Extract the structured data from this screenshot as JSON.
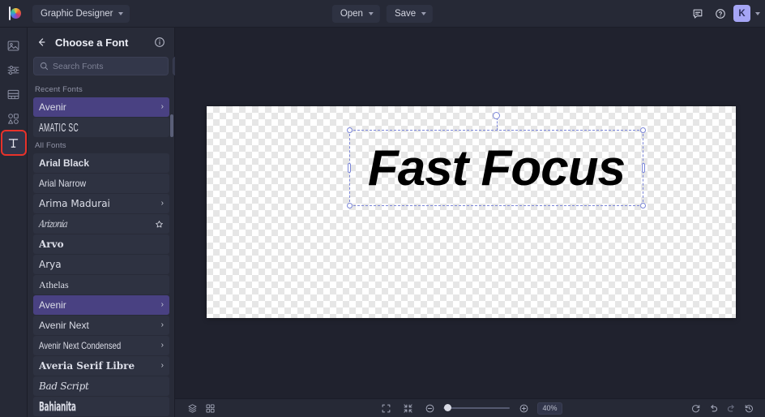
{
  "app": {
    "document_name": "Graphic Designer",
    "logo_icon": "pixlr-logo-icon"
  },
  "topbar": {
    "open_label": "Open",
    "save_label": "Save",
    "chat_icon": "chat-bubble-icon",
    "help_icon": "help-circle-icon",
    "avatar_initial": "K"
  },
  "left_rail": [
    {
      "name": "sidebar-item-image",
      "icon": "image-icon",
      "active": false
    },
    {
      "name": "sidebar-item-adjust",
      "icon": "sliders-icon",
      "active": false
    },
    {
      "name": "sidebar-item-layout",
      "icon": "layout-icon",
      "active": false
    },
    {
      "name": "sidebar-item-shapes",
      "icon": "shapes-icon",
      "active": false
    },
    {
      "name": "sidebar-item-text",
      "icon": "text-tool-icon",
      "active": true
    }
  ],
  "panel": {
    "back_icon": "back-arrow-icon",
    "title": "Choose a Font",
    "info_icon": "info-circle-icon",
    "search": {
      "icon": "search-icon",
      "placeholder": "Search Fonts",
      "value": ""
    },
    "favorites_icon": "star-icon",
    "add_icon": "plus-icon",
    "recent_label": "Recent Fonts",
    "all_label": "All Fonts",
    "recent_fonts": [
      {
        "name": "Avenir",
        "style": "f-avenir",
        "chevron": true,
        "star": false,
        "selected": true
      },
      {
        "name": "AMATIC SC",
        "style": "f-amatic",
        "chevron": false,
        "star": false,
        "selected": false
      }
    ],
    "all_fonts": [
      {
        "name": "Arial Black",
        "style": "f-arial-black",
        "chevron": false,
        "star": false,
        "selected": false
      },
      {
        "name": "Arial Narrow",
        "style": "f-arial-narrow",
        "chevron": false,
        "star": false,
        "selected": false
      },
      {
        "name": "Arima Madurai",
        "style": "f-arima",
        "chevron": true,
        "star": false,
        "selected": false
      },
      {
        "name": "Arizonia",
        "style": "f-script",
        "chevron": false,
        "star": true,
        "selected": false
      },
      {
        "name": "Arvo",
        "style": "f-arvo",
        "chevron": false,
        "star": false,
        "selected": false
      },
      {
        "name": "Arya",
        "style": "f-arya",
        "chevron": false,
        "star": false,
        "selected": false
      },
      {
        "name": "Athelas",
        "style": "f-athelas",
        "chevron": false,
        "star": false,
        "selected": false
      },
      {
        "name": "Avenir",
        "style": "f-avenir",
        "chevron": true,
        "star": false,
        "selected": true
      },
      {
        "name": "Avenir Next",
        "style": "f-avenir",
        "chevron": true,
        "star": false,
        "selected": false
      },
      {
        "name": "Avenir Next Condensed",
        "style": "f-avenir-cond",
        "chevron": true,
        "star": false,
        "selected": false
      },
      {
        "name": "Averia Serif Libre",
        "style": "f-averia",
        "chevron": true,
        "star": false,
        "selected": false
      },
      {
        "name": "Bad Script",
        "style": "f-bad-script",
        "chevron": false,
        "star": false,
        "selected": false
      },
      {
        "name": "Bahianita",
        "style": "f-bahianita",
        "chevron": false,
        "star": false,
        "selected": false
      }
    ]
  },
  "canvas": {
    "text_layer_value": "Fast Focus"
  },
  "bottombar": {
    "layers_icon": "layers-icon",
    "grid_icon": "grid-icon",
    "fit_icon": "fit-to-screen-icon",
    "actual_icon": "actual-size-icon",
    "zoom_out_icon": "zoom-out-icon",
    "zoom_in_icon": "zoom-in-icon",
    "zoom_level": "40%",
    "refresh_icon": "refresh-icon",
    "undo_icon": "undo-icon",
    "redo_icon": "redo-icon",
    "history_icon": "history-icon"
  },
  "colors": {
    "app_bg": "#20222e",
    "panel_bg": "#282b38",
    "chrome_bg": "#262936",
    "accent_selected": "#494182",
    "avatar_bg": "#a5a5f5",
    "selection_outline": "#7b86d8",
    "annotation_outline": "#e8322a"
  }
}
